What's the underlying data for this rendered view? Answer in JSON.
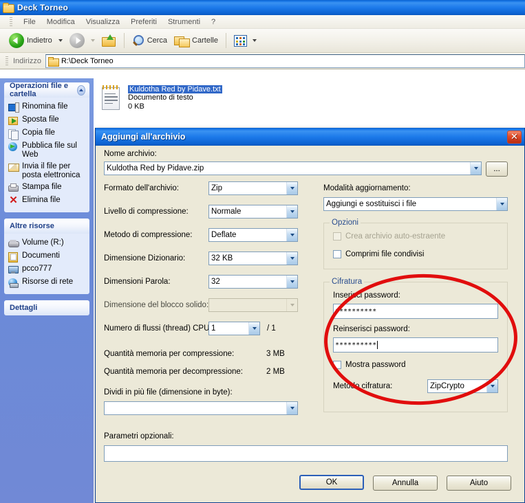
{
  "explorer": {
    "title": "Deck Torneo",
    "menu": [
      "File",
      "Modifica",
      "Visualizza",
      "Preferiti",
      "Strumenti",
      "?"
    ],
    "toolbar": {
      "back": "Indietro",
      "search": "Cerca",
      "folders": "Cartelle"
    },
    "address": {
      "label": "Indirizzo",
      "value": "R:\\Deck Torneo"
    },
    "sidebar": {
      "panels": [
        {
          "title": "Operazioni file e cartella",
          "collapsible": true,
          "items": [
            {
              "icon": "rename-icon",
              "label": "Rinomina file"
            },
            {
              "icon": "move-icon",
              "label": "Sposta file"
            },
            {
              "icon": "copy-icon",
              "label": "Copia file"
            },
            {
              "icon": "publish-web-icon",
              "label": "Pubblica file sul Web"
            },
            {
              "icon": "mail-icon",
              "label": "Invia il file per posta elettronica"
            },
            {
              "icon": "print-icon",
              "label": "Stampa file"
            },
            {
              "icon": "delete-icon",
              "label": "Elimina file"
            }
          ]
        },
        {
          "title": "Altre risorse",
          "collapsible": false,
          "items": [
            {
              "icon": "drive-icon",
              "label": "Volume (R:)"
            },
            {
              "icon": "documents-icon",
              "label": "Documenti"
            },
            {
              "icon": "computer-icon",
              "label": "pcco777"
            },
            {
              "icon": "network-icon",
              "label": "Risorse di rete"
            }
          ]
        },
        {
          "title": "Dettagli",
          "collapsible": false,
          "items": []
        }
      ]
    },
    "files": [
      {
        "name": "Kuldotha Red by Pidave.txt",
        "type": "Documento di testo",
        "size": "0 KB",
        "selected": true
      }
    ]
  },
  "dialog": {
    "title": "Aggiungi all'archivio",
    "close_label": "✕",
    "archive_name_label": "Nome archivio:",
    "archive_name_value": "Kuldotha Red by Pidave.zip",
    "browse_label": "...",
    "fields": [
      {
        "label": "Formato dell'archivio:",
        "value": "Zip",
        "disabled": false
      },
      {
        "label": "Livello di compressione:",
        "value": "Normale",
        "disabled": false
      },
      {
        "label": "Metodo di compressione:",
        "value": "Deflate",
        "disabled": false
      },
      {
        "label": "Dimensione Dizionario:",
        "value": "32 KB",
        "disabled": false
      },
      {
        "label": "Dimensioni Parola:",
        "value": "32",
        "disabled": false
      },
      {
        "label": "Dimensione del blocco solido:",
        "value": "",
        "disabled": true
      }
    ],
    "threads_label": "Numero di flussi (thread) CPU:",
    "threads_value": "1",
    "threads_total": "/ 1",
    "mem_compress_label": "Quantità memoria per compressione:",
    "mem_compress_value": "3 MB",
    "mem_decompress_label": "Quantità memoria per decompressione:",
    "mem_decompress_value": "2 MB",
    "split_label": "Dividi in più file (dimensione in byte):",
    "split_value": "",
    "params_label": "Parametri opzionali:",
    "params_value": "",
    "update_mode_label": "Modalità aggiornamento:",
    "update_mode_value": "Aggiungi e sostituisci i file",
    "options_group_title": "Opzioni",
    "options": [
      {
        "label": "Crea archivio auto-estraente",
        "checked": false,
        "disabled": true
      },
      {
        "label": "Comprimi file condivisi",
        "checked": false,
        "disabled": false
      }
    ],
    "encryption_group_title": "Cifratura",
    "password_label": "Inserisci password:",
    "password_value": "**********",
    "password_repeat_label": "Reinserisci password:",
    "password_repeat_value": "**********",
    "show_password_label": "Mostra password",
    "show_password_checked": false,
    "encryption_method_label": "Metodo cifratura:",
    "encryption_method_value": "ZipCrypto",
    "buttons": {
      "ok": "OK",
      "cancel": "Annulla",
      "help": "Aiuto"
    }
  },
  "annotation": {
    "shape": "ellipse",
    "color": "#e10d0d",
    "target": "encryption-group"
  }
}
